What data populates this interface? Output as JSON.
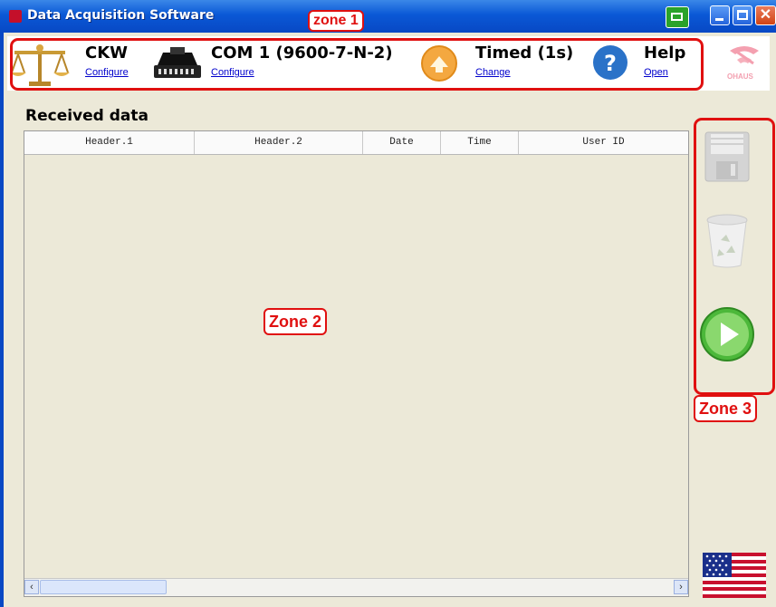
{
  "window": {
    "title": "Data Acquisition Software"
  },
  "annotations": {
    "zone1": "zone 1",
    "zone2": "Zone 2",
    "zone3": "Zone 3"
  },
  "toolbar": {
    "balance": {
      "title": "CKW",
      "link": "Configure"
    },
    "port": {
      "title": "COM 1 (9600-7-N-2)",
      "link": "Configure"
    },
    "mode": {
      "title": "Timed (1s)",
      "link": "Change"
    },
    "help": {
      "title": "Help",
      "link": "Open"
    },
    "brand": "OHAUS"
  },
  "main": {
    "heading": "Received data",
    "columns": [
      "Header.1",
      "Header.2",
      "Date",
      "Time",
      "User ID"
    ]
  },
  "icons": {
    "printer": "printer-icon",
    "balance": "scale-icon",
    "port": "serial-port-icon",
    "mode": "mode-arrow-icon",
    "help": "help-icon",
    "save": "floppy-disk-icon",
    "trash": "recycle-bin-icon",
    "start": "play-icon",
    "language": "us-flag-icon"
  },
  "colors": {
    "accent": "#e01010",
    "titlebar": "#0a58d6",
    "link": "#0000cc"
  }
}
